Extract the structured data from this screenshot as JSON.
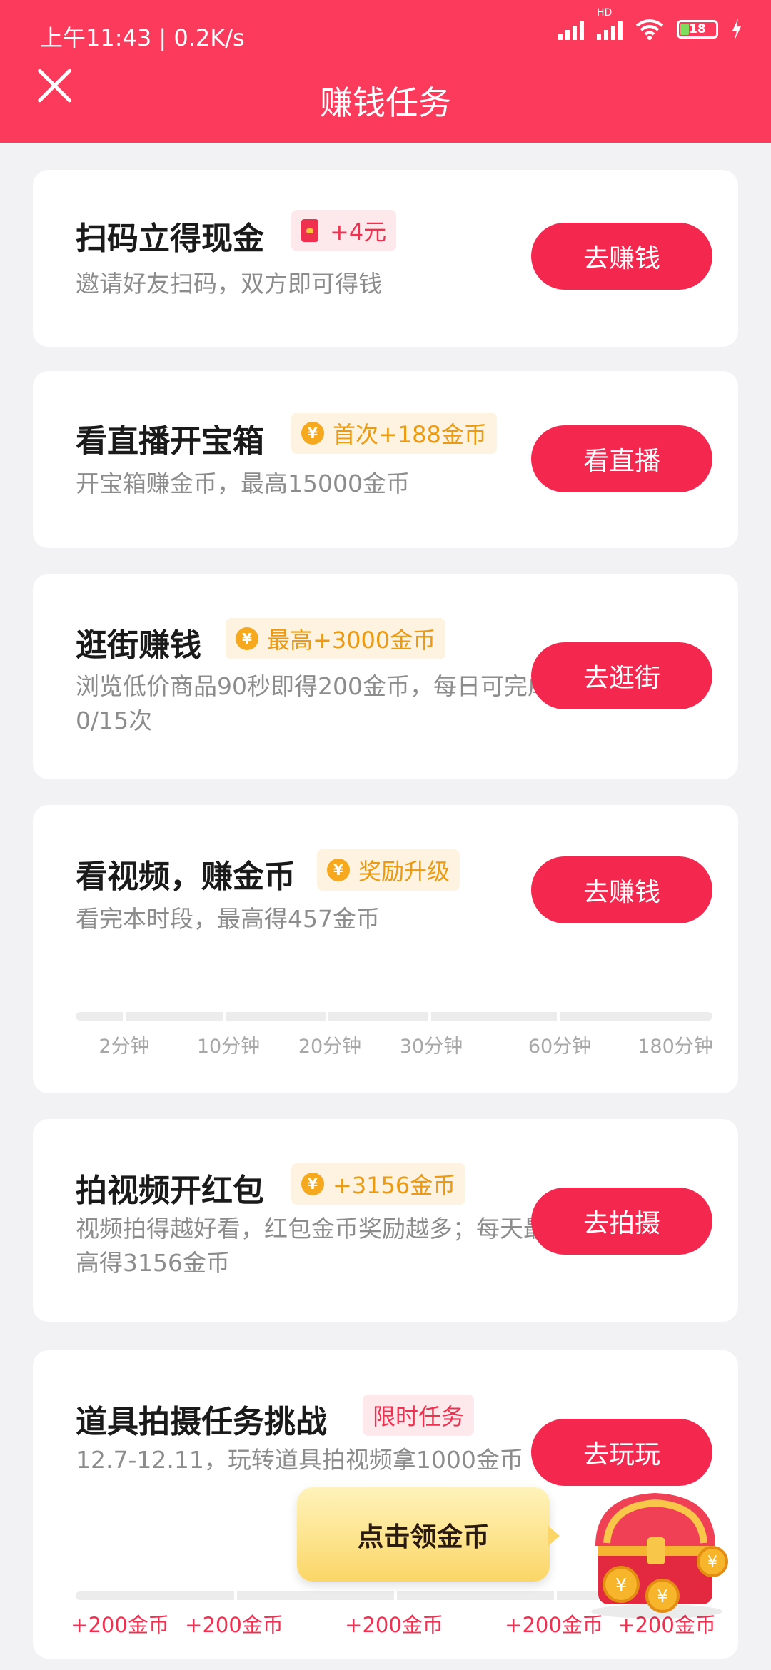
{
  "status_bar": {
    "time": "上午11:43 | 0.2K/s",
    "hd": "HD",
    "battery": "18"
  },
  "header": {
    "title": "赚钱任务"
  },
  "tasks": [
    {
      "title": "扫码立得现金",
      "tag": "+4元",
      "desc": "邀请好友扫码，双方即可得钱",
      "button": "去赚钱"
    },
    {
      "title": "看直播开宝箱",
      "tag": "首次+188金币",
      "desc": "开宝箱赚金币，最高15000金币",
      "button": "看直播"
    },
    {
      "title": "逛街赚钱",
      "tag": "最高+3000金币",
      "desc": "浏览低价商品90秒即得200金币，每日可完成0/15次",
      "button": "去逛街"
    },
    {
      "title": "看视频，赚金币",
      "tag": "奖励升级",
      "desc": "看完本时段，最高得457金币",
      "button": "去赚钱",
      "progress_labels": [
        "2分钟",
        "10分钟",
        "20分钟",
        "30分钟",
        "60分钟",
        "180分钟"
      ]
    },
    {
      "title": "拍视频开红包",
      "tag": "+3156金币",
      "desc": "视频拍得越好看，红包金币奖励越多；每天最高得3156金币",
      "button": "去拍摄"
    },
    {
      "title": "道具拍摄任务挑战",
      "tag": "限时任务",
      "desc": "12.7-12.11，玩转道具拍视频拿1000金币",
      "button": "去玩玩",
      "reward_labels": [
        "+200金币",
        "+200金币",
        "+200金币",
        "+200金币",
        "+200金币"
      ]
    }
  ],
  "float_button": {
    "label": "点击领金币"
  },
  "coin_symbol": "¥",
  "colors": {
    "brand": "#fb3a5c",
    "button": "#f4284f",
    "gold": "#eb9a12"
  }
}
